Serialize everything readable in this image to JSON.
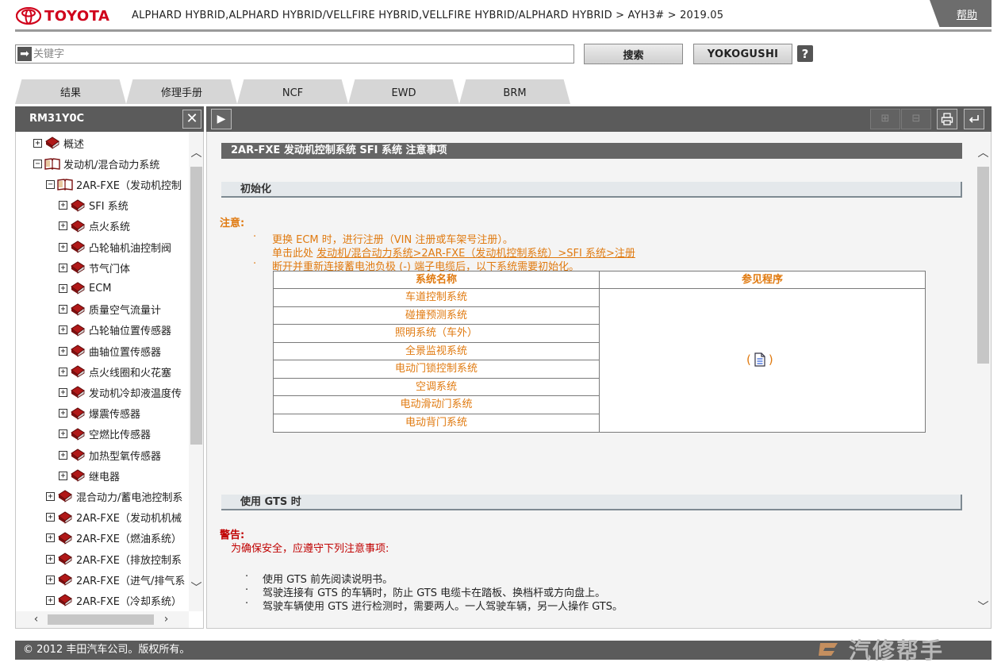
{
  "header": {
    "logo_text": "TOYOTA",
    "breadcrumb": "ALPHARD HYBRID,ALPHARD HYBRID/VELLFIRE HYBRID,VELLFIRE HYBRID/ALPHARD HYBRID > AYH3# > 2019.05",
    "help_label": "帮助",
    "brand_color": "#d0021b"
  },
  "search": {
    "placeholder": "关键字",
    "value": "",
    "search_label": "搜索",
    "yokogushi_label": "YOKOGUSHI",
    "help_icon_label": "?"
  },
  "tabs": [
    {
      "label": "结果"
    },
    {
      "label": "修理手册"
    },
    {
      "label": "NCF"
    },
    {
      "label": "EWD"
    },
    {
      "label": "BRM"
    }
  ],
  "toolbar": {
    "doc_id": "RM31Y0C",
    "close_label": "✕",
    "expand_label": "▶",
    "zoom_in_label": "⊞",
    "zoom_out_label": "⊟",
    "print_icon": "printer-icon",
    "back_icon": "return-icon"
  },
  "tree": {
    "items": [
      {
        "label": "概述",
        "toggle": "+",
        "level": 0,
        "open": false
      },
      {
        "label": "发动机/混合动力系统",
        "toggle": "−",
        "level": 0,
        "open": true
      },
      {
        "label": "2AR-FXE（发动机控制",
        "toggle": "−",
        "level": 1,
        "open": true
      },
      {
        "label": "SFI 系统",
        "toggle": "+",
        "level": 2,
        "open": false
      },
      {
        "label": "点火系统",
        "toggle": "+",
        "level": 2,
        "open": false
      },
      {
        "label": "凸轮轴机油控制阀",
        "toggle": "+",
        "level": 2,
        "open": false
      },
      {
        "label": "节气门体",
        "toggle": "+",
        "level": 2,
        "open": false
      },
      {
        "label": "ECM",
        "toggle": "+",
        "level": 2,
        "open": false
      },
      {
        "label": "质量空气流量计",
        "toggle": "+",
        "level": 2,
        "open": false
      },
      {
        "label": "凸轮轴位置传感器",
        "toggle": "+",
        "level": 2,
        "open": false
      },
      {
        "label": "曲轴位置传感器",
        "toggle": "+",
        "level": 2,
        "open": false
      },
      {
        "label": "点火线圈和火花塞",
        "toggle": "+",
        "level": 2,
        "open": false
      },
      {
        "label": "发动机冷却液温度传",
        "toggle": "+",
        "level": 2,
        "open": false
      },
      {
        "label": "爆震传感器",
        "toggle": "+",
        "level": 2,
        "open": false
      },
      {
        "label": "空燃比传感器",
        "toggle": "+",
        "level": 2,
        "open": false
      },
      {
        "label": "加热型氧传感器",
        "toggle": "+",
        "level": 2,
        "open": false
      },
      {
        "label": "继电器",
        "toggle": "+",
        "level": 2,
        "open": false
      },
      {
        "label": "混合动力/蓄电池控制系",
        "toggle": "+",
        "level": 1,
        "open": false
      },
      {
        "label": "2AR-FXE（发动机机械",
        "toggle": "+",
        "level": 1,
        "open": false
      },
      {
        "label": "2AR-FXE（燃油系统）",
        "toggle": "+",
        "level": 1,
        "open": false
      },
      {
        "label": "2AR-FXE（排放控制系",
        "toggle": "+",
        "level": 1,
        "open": false
      },
      {
        "label": "2AR-FXE（进气/排气系",
        "toggle": "+",
        "level": 1,
        "open": false
      },
      {
        "label": "2AR-FXE（冷却系统）",
        "toggle": "+",
        "level": 1,
        "open": false
      }
    ]
  },
  "content": {
    "title": "2AR-FXE 发动机控制系统  SFI 系统  注意事项",
    "sections": {
      "init": "初始化",
      "gts": "使用 GTS 时"
    },
    "caution_label": "注意:",
    "notes": {
      "bullet": "·",
      "note1": "更换 ECM 时，进行注册（VIN 注册或车架号注册）。",
      "link_prefix": "单击此处 ",
      "link_text": "发动机/混合动力系统>2AR-FXE（发动机控制系统）>SFI 系统>注册",
      "note2": "断开并重新连接蓄电池负极 (-) 端子电缆后，以下系统需要初始化。"
    },
    "table": {
      "headers": [
        "系统名称",
        "参见程序"
      ],
      "rows": [
        "车道控制系统",
        "碰撞预测系统",
        "照明系统（车外）",
        "全景监视系统",
        "电动门锁控制系统",
        "空调系统",
        "电动滑动门系统",
        "电动背门系统"
      ],
      "ref_open": "(",
      "ref_close": ")"
    },
    "warning_label": "警告:",
    "warning_intro": "为确保安全，应遵守下列注意事项:",
    "gts_bullet": "·",
    "gts_items": [
      "使用 GTS 前先阅读说明书。",
      "驾驶连接有 GTS 的车辆时，防止 GTS 电缆卡在踏板、换档杆或方向盘上。",
      "驾驶车辆使用 GTS 进行检测时，需要两人。一人驾驶车辆，另一人操作 GTS。"
    ],
    "note_color": "#e07a10",
    "warning_color": "#c00000"
  },
  "footer": {
    "copyright": "© 2012 丰田汽车公司。版权所有。",
    "watermark": "汽修帮手"
  }
}
